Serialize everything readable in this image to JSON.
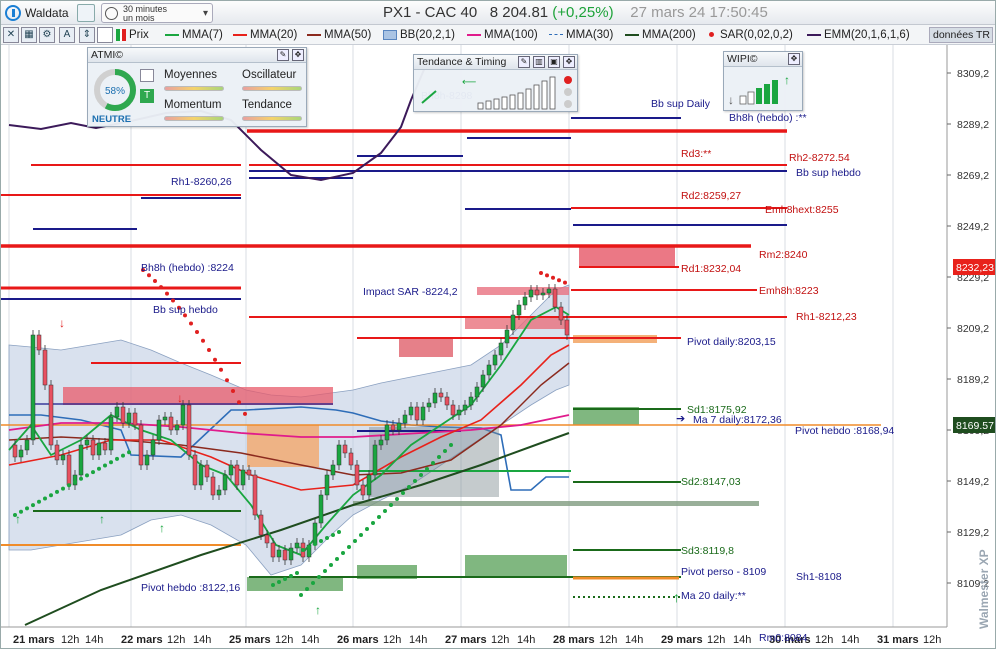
{
  "window": {
    "app_name": "Waldata",
    "timeframe_line1": "30 minutes",
    "timeframe_line2": "un mois",
    "instrument": "PX1 - CAC 40",
    "last_price": "8 204.81",
    "change": "(+0,25%)",
    "datetime": "27 mars 24 17:50:45",
    "data_button": "données TR"
  },
  "toolbar": {
    "indicators": [
      {
        "label": "Prix",
        "color": "#333333"
      },
      {
        "label": "MMA(7)",
        "color": "#1aa640"
      },
      {
        "label": "MMA(20)",
        "color": "#e8221b"
      },
      {
        "label": "MMA(50)",
        "color": "#8b2a1e"
      },
      {
        "label": "BB(20,2,1)",
        "color": "#1f5faa"
      },
      {
        "label": "MMA(100)",
        "color": "#e01b8c"
      },
      {
        "label": "MMA(30)",
        "color": "#2e6db8"
      },
      {
        "label": "MMA(200)",
        "color": "#1f4d1f"
      },
      {
        "label": "SAR(0,02,0,2)",
        "color": "#e02020"
      },
      {
        "label": "EMM(20,1,6,1,6)",
        "color": "#3c1a5a"
      }
    ]
  },
  "panels": {
    "atmi": {
      "title": "ATMI©",
      "percent": "58%",
      "state": "NEUTRE",
      "labels": [
        "Moyennes",
        "Oscillateur",
        "Momentum",
        "Tendance"
      ]
    },
    "tendance": {
      "title": "Tendance & Timing"
    },
    "wipi": {
      "title": "WIPI©"
    }
  },
  "price_axis": {
    "ticks": [
      "8309,2",
      "8289,2",
      "8269,2",
      "8249,2",
      "8229,2",
      "8209,2",
      "8189,2",
      "8169,2",
      "8149,2",
      "8129,2",
      "8109,2"
    ],
    "current_price": "8232,23",
    "current_price_color": "#e8221b",
    "ma_price": "8169.57",
    "ma_price_color": "#1f4d1f"
  },
  "time_axis": {
    "labels": [
      "21 mars",
      "12h",
      "14h",
      "22 mars",
      "12h",
      "14h",
      "25 mars",
      "12h",
      "14h",
      "26 mars",
      "12h",
      "14h",
      "27 mars",
      "12h",
      "14h",
      "28 mars",
      "12h",
      "14h",
      "29 mars",
      "12h",
      "14h",
      "30 mars",
      "12h",
      "14h",
      "31 mars",
      "12h"
    ]
  },
  "annotations": [
    {
      "text": "Bb sup Daily",
      "color": "#1a1a8a"
    },
    {
      "text": "Bh8h (hebdo) :**",
      "color": "#1a1a8a"
    },
    {
      "text": "Rd3:**",
      "color": "#c21010"
    },
    {
      "text": "Rh2-8272.54",
      "color": "#c21010"
    },
    {
      "text": "Bb sup hebdo",
      "color": "#1a1a8a"
    },
    {
      "text": "Rh1-8260,26",
      "color": "#1a1a8a"
    },
    {
      "text": "Rd2:8259,27",
      "color": "#c21010"
    },
    {
      "text": "Emh8hext:8255",
      "color": "#c21010"
    },
    {
      "text": "Rm2:8240",
      "color": "#c21010"
    },
    {
      "text": "Rd1:8232,04",
      "color": "#c21010"
    },
    {
      "text": "Bh8h (hebdo) :8224",
      "color": "#1a1a8a"
    },
    {
      "text": "Impact SAR -8224,2",
      "color": "#1a1a8a"
    },
    {
      "text": "Emh8h:8223",
      "color": "#c21010"
    },
    {
      "text": "Bb sup hebdo",
      "color": "#1a1a8a"
    },
    {
      "text": "Rh1-8212,23",
      "color": "#c21010"
    },
    {
      "text": "Pivot daily:8203,15",
      "color": "#1a1a8a"
    },
    {
      "text": "Sd1:8175,92",
      "color": "#1a6a1a"
    },
    {
      "text": "Ma 7 daily:8172,36",
      "color": "#1a1a8a"
    },
    {
      "text": "Pivot hebdo :8168,94",
      "color": "#1a1a8a"
    },
    {
      "text": "Sd2:8147,03",
      "color": "#1a6a1a"
    },
    {
      "text": "Sd3:8119,8",
      "color": "#1a6a1a"
    },
    {
      "text": "Pivot hebdo :8122,16",
      "color": "#1a1a8a"
    },
    {
      "text": "Pivot perso - 8109",
      "color": "#1a1a8a"
    },
    {
      "text": "Sh1-8108",
      "color": "#1a1a8a"
    },
    {
      "text": "Ma 20 daily:**",
      "color": "#1a1a8a"
    },
    {
      "text": "Bh8h-8298",
      "color": "#1a1a8a"
    },
    {
      "text": "Rm0:8084",
      "color": "#1a1a8a"
    }
  ],
  "watermark": "Walmester XP"
}
